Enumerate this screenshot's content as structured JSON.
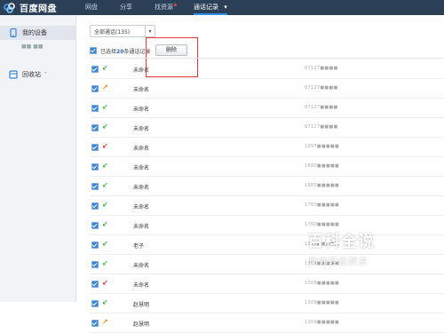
{
  "topbar": {
    "logo_text": "百度网盘",
    "nav": [
      {
        "label": "网盘",
        "active": false,
        "dot": false
      },
      {
        "label": "分享",
        "active": false,
        "dot": false
      },
      {
        "label": "找资源",
        "active": false,
        "dot": true
      },
      {
        "label": "通话记录",
        "active": true,
        "dot": false
      }
    ],
    "nav_caret": "▾"
  },
  "sidebar": {
    "device_label": "我的设备",
    "device_sub": "■■ ■■",
    "recycle_label": "回收站",
    "recycle_caret": "˅"
  },
  "toolbar": {
    "filter_value": "全部通话(135)",
    "filter_arrow": "▾",
    "selected_prefix": "已选择",
    "selected_count": "20",
    "selected_suffix": "条通话记录",
    "delete_label": "删除"
  },
  "rows": [
    {
      "type": "in",
      "icon": "↙",
      "name": "未命名",
      "number": "07127■■■■"
    },
    {
      "type": "out",
      "icon": "↗",
      "name": "未命名",
      "number": "07127■■■■"
    },
    {
      "type": "in",
      "icon": "↙",
      "name": "未命名",
      "number": "07127■■■■"
    },
    {
      "type": "in",
      "icon": "↙",
      "name": "未命名",
      "number": "07127■■■■"
    },
    {
      "type": "miss",
      "icon": "↙",
      "name": "未命名",
      "number": "1997■■■■■"
    },
    {
      "type": "in",
      "icon": "↙",
      "name": "未命名",
      "number": "1880■■■■■"
    },
    {
      "type": "in",
      "icon": "↙",
      "name": "未命名",
      "number": "1880■■■■■"
    },
    {
      "type": "in",
      "icon": "↙",
      "name": "未命名",
      "number": "1780■■■■■"
    },
    {
      "type": "in",
      "icon": "↙",
      "name": "未命名",
      "number": "1780■■■■■"
    },
    {
      "type": "in",
      "icon": "↙",
      "name": "老子",
      "number": "1309■■■■■"
    },
    {
      "type": "in",
      "icon": "↙",
      "name": "未命名",
      "number": "1309■■■■■"
    },
    {
      "type": "miss",
      "icon": "↙",
      "name": "未命名",
      "number": "1309■■■■■"
    },
    {
      "type": "in",
      "icon": "↙",
      "name": "赵慧明",
      "number": "1309■■■■■"
    },
    {
      "type": "out",
      "icon": "↗",
      "name": "赵慧明",
      "number": "1309■■■■■"
    }
  ],
  "watermark": {
    "title": "百科全说",
    "subtitle": "助你轻松解决"
  },
  "colors": {
    "topbar": "#2b3f56",
    "accent": "#2f8fe8",
    "incoming": "#3db94a",
    "outgoing": "#f08a1f",
    "missed": "#e03a3a",
    "highlight": "#e23b3b"
  }
}
